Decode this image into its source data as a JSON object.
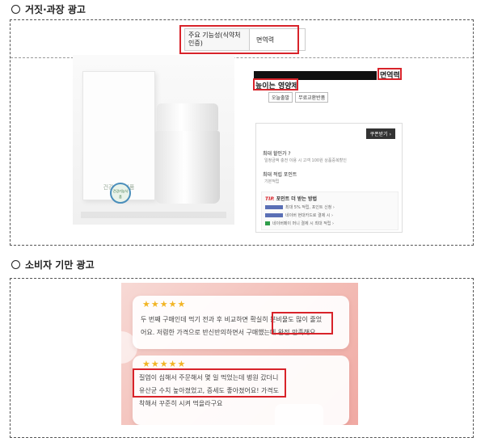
{
  "section1": {
    "title": "거짓·과장 광고",
    "func_label": "주요 기능성(식약처인증)",
    "func_value": "면역력",
    "product": {
      "title_tail": "면역력",
      "subtitle": "높이는 영양제",
      "chips": [
        "오늘출발",
        "무료교환반품"
      ],
      "box_label": "건강기능식품",
      "seal_text": "건강기능식품"
    },
    "panel": {
      "coupon": "쿠폰받기 ›",
      "discount_label": "최대 할인가 ?",
      "discount_sub": "일정금액 충전 이용 시 고객 100원 상품중복할인",
      "points_label": "최대 적립 포인트",
      "points_sub": "기본적립",
      "tip_prefix": "TIP.",
      "tip_text": "포인트 더 받는 방법",
      "tip_lines": [
        "최대 5% 적립, 포인트 신청 ›",
        "네이버 현대카드로 결제 시 ›",
        "네이버페이 머니 결제 시 최대 적립 ›"
      ]
    }
  },
  "section2": {
    "title": "소비자 기만 광고",
    "review1": {
      "stars": "★★★★★",
      "line1": "두 번째 구매인데 먹기 전과 후 비교하면 확실히 분비물도 많이 줄었",
      "line2": "어요. 저렴한 가격으로 반신반의하면서 구매했는데 완전 만족해요."
    },
    "review2": {
      "stars": "★★★★★",
      "line1": "질염이 심해서 주문해서 몇 일 먹었는데 병원 갔더니",
      "line2": "유산균 수치 높아졌었고, 증세도 좋아졌어요! 가격도",
      "line3": "착해서 꾸준히 시켜 먹을라구요"
    }
  },
  "colors": {
    "highlight": "#d8232a",
    "star": "#f2b526",
    "review_bg": "#f3bdb6"
  }
}
